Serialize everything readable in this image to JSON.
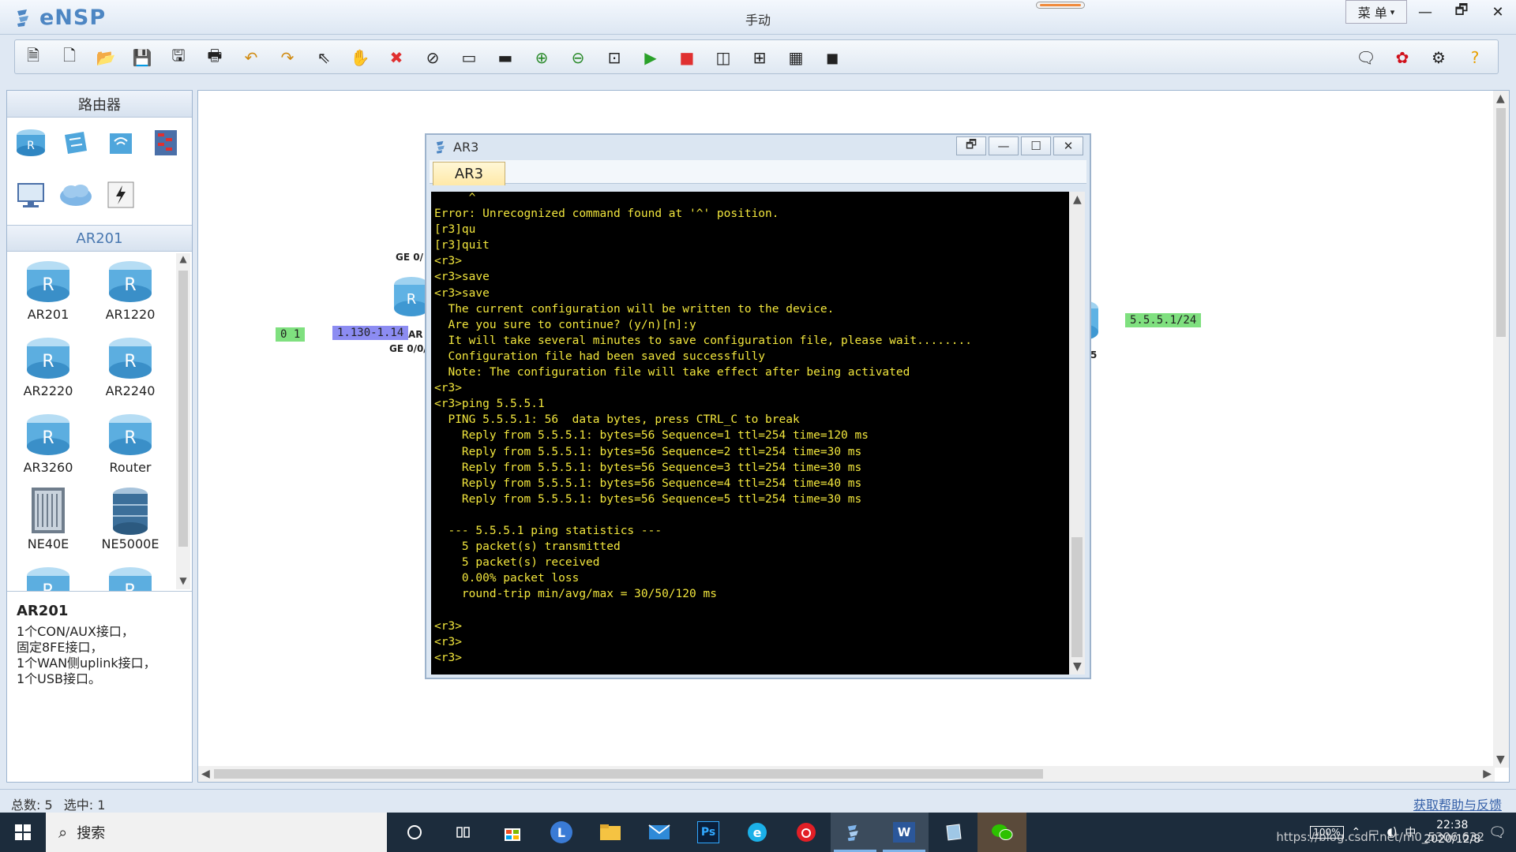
{
  "app": {
    "name": "eNSP",
    "window_title": "手动",
    "menu_label": "菜 单",
    "window_buttons": [
      "—",
      "🗗",
      "✕"
    ]
  },
  "toolbar": {
    "left_icons": [
      "new-topology-icon",
      "new-page-icon",
      "open-icon",
      "save-icon",
      "save-as-icon",
      "print-icon",
      "undo-icon",
      "redo-icon",
      "pointer-icon",
      "pan-hand-icon",
      "delete-icon",
      "delete-link-icon",
      "text-note-icon",
      "rectangle-icon",
      "zoom-in-icon",
      "zoom-out-icon",
      "fit-icon",
      "start-device-icon",
      "stop-device-icon",
      "capture-icon",
      "topology-icon",
      "grid-icon",
      "screenshot-icon"
    ],
    "right_icons": [
      "feedback-icon",
      "huawei-logo-icon",
      "settings-icon",
      "help-icon"
    ]
  },
  "left_panel": {
    "category_title": "路由器",
    "categories": [
      "router-category-icon",
      "switch-category-icon",
      "wireless-category-icon",
      "firewall-category-icon",
      "pc-category-icon",
      "cloud-category-icon",
      "connection-category-icon"
    ],
    "subcategory_title": "AR201",
    "devices": [
      {
        "label": "AR201",
        "kind": "router"
      },
      {
        "label": "AR1220",
        "kind": "router"
      },
      {
        "label": "AR2220",
        "kind": "router"
      },
      {
        "label": "AR2240",
        "kind": "router"
      },
      {
        "label": "AR3260",
        "kind": "router"
      },
      {
        "label": "Router",
        "kind": "router"
      },
      {
        "label": "NE40E",
        "kind": "chassis"
      },
      {
        "label": "NE5000E",
        "kind": "stack"
      }
    ],
    "description": {
      "title": "AR201",
      "lines": [
        "1个CON/AUX接口，",
        "固定8FE接口，",
        "1个WAN侧uplink接口，",
        "1个USB接口。"
      ]
    }
  },
  "canvas": {
    "tag_green_left": "0  1",
    "tag_blue_left": "1.130-1.14",
    "port_top": "GE 0/",
    "port_bottom": "GE 0/0/",
    "port_ar": "AR",
    "tag_green_right": "5.5.5.1/24",
    "right_port_fragment": "5"
  },
  "console": {
    "title": "AR3",
    "tab": "AR3",
    "buttons": [
      "restore-icon",
      "minimize-icon",
      "maximize-icon",
      "close-icon"
    ],
    "lines": [
      "     ^",
      "Error: Unrecognized command found at '^' position.",
      "[r3]qu",
      "[r3]quit",
      "<r3>",
      "<r3>save",
      "<r3>save",
      "  The current configuration will be written to the device.",
      "  Are you sure to continue? (y/n)[n]:y",
      "  It will take several minutes to save configuration file, please wait........",
      "  Configuration file had been saved successfully",
      "  Note: The configuration file will take effect after being activated",
      "<r3>",
      "<r3>ping 5.5.5.1",
      "  PING 5.5.5.1: 56  data bytes, press CTRL_C to break",
      "    Reply from 5.5.5.1: bytes=56 Sequence=1 ttl=254 time=120 ms",
      "    Reply from 5.5.5.1: bytes=56 Sequence=2 ttl=254 time=30 ms",
      "    Reply from 5.5.5.1: bytes=56 Sequence=3 ttl=254 time=30 ms",
      "    Reply from 5.5.5.1: bytes=56 Sequence=4 ttl=254 time=40 ms",
      "    Reply from 5.5.5.1: bytes=56 Sequence=5 ttl=254 time=30 ms",
      "",
      "  --- 5.5.5.1 ping statistics ---",
      "    5 packet(s) transmitted",
      "    5 packet(s) received",
      "    0.00% packet loss",
      "    round-trip min/avg/max = 30/50/120 ms",
      "",
      "<r3>",
      "<r3>",
      "<r3>"
    ]
  },
  "statusbar": {
    "total_label": "总数:",
    "total_value": "5",
    "selected_label": "选中:",
    "selected_value": "1",
    "help_link": "获取帮助与反馈"
  },
  "taskbar": {
    "search_placeholder": "搜索",
    "apps": [
      "cortana-icon",
      "task-view-icon",
      "store-icon",
      "l-app-icon",
      "file-explorer-icon",
      "mail-icon",
      "photoshop-icon",
      "ie-browser-icon",
      "netease-music-icon",
      "ensp-icon",
      "word-icon",
      "virtualbox-icon",
      "wechat-icon"
    ],
    "ps_label": "Ps",
    "word_label": "W",
    "l_label": "L",
    "battery": "100%",
    "ime": "中",
    "time": "22:38",
    "date": "2020/12/8",
    "watermark": "https://blog.csdn.net/m0_5306.632"
  },
  "colors": {
    "terminal_text": "#f2e63d",
    "tag_green": "#7fe07f",
    "tag_blue": "#8c8cf2",
    "accent_blue": "#4d86c3"
  }
}
